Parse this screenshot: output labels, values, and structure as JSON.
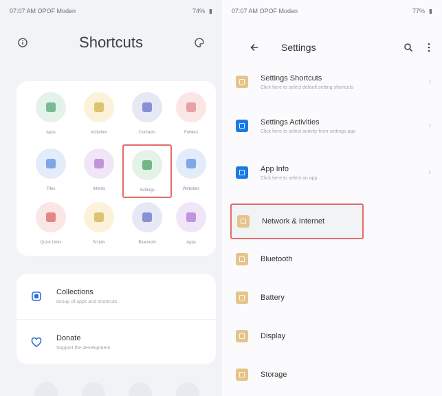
{
  "colors": {
    "highlight": "#e36b6b",
    "settings_orange": "#e5c48a",
    "settings_blue": "#1a7be6",
    "accent_blue": "#2e6fd8"
  },
  "left_panel": {
    "status": {
      "time_carrier": "07:07 AM  OPOF  Moden",
      "battery": "74%"
    },
    "header": {
      "title": "Shortcuts",
      "left_icon": "info-icon",
      "right_icon": "palette-icon"
    },
    "tiles": [
      {
        "label": "Apps",
        "bg": "#e4f3ea",
        "fg": "#5aa77a",
        "icon": "apps-icon"
      },
      {
        "label": "Activities",
        "bg": "#fbf2d9",
        "fg": "#d6b24b",
        "icon": "activities-icon"
      },
      {
        "label": "Contacts",
        "bg": "#e6e8f6",
        "fg": "#6b73c9",
        "icon": "contacts-icon"
      },
      {
        "label": "Folders",
        "bg": "#fbe6e6",
        "fg": "#e08c8c",
        "icon": "folder-icon"
      },
      {
        "label": "Files",
        "bg": "#e3ecfb",
        "fg": "#5f8fe0",
        "icon": "file-icon"
      },
      {
        "label": "Intents",
        "bg": "#f1e6f8",
        "fg": "#b07ad6",
        "icon": "intent-icon"
      },
      {
        "label": "Settings",
        "bg": "#e4f2e7",
        "fg": "#4ea067",
        "icon": "settings-icon"
      },
      {
        "label": "Websites",
        "bg": "#e3ecfb",
        "fg": "#5f8fe0",
        "icon": "web-icon"
      },
      {
        "label": "Quick Links",
        "bg": "#fbe6e6",
        "fg": "#e06666",
        "icon": "close-icon"
      },
      {
        "label": "Scripts",
        "bg": "#fbf2d9",
        "fg": "#d6b24b",
        "icon": "script-icon"
      },
      {
        "label": "Bluetooth",
        "bg": "#e6e8f6",
        "fg": "#6b73c9",
        "icon": "bluetooth-icon"
      },
      {
        "label": "Apps",
        "bg": "#f1e6f8",
        "fg": "#b07ad6",
        "icon": "grid-icon"
      }
    ],
    "collections": {
      "title": "Collections",
      "subtitle": "Group of apps and shortcuts"
    },
    "donate": {
      "title": "Donate",
      "subtitle": "Support the development"
    }
  },
  "right_panel": {
    "status": {
      "time_carrier": "07:07 AM  OPOF  Moden",
      "battery": "77%"
    },
    "header": {
      "title": "Settings",
      "back_icon": "back-arrow-icon",
      "search_icon": "search-icon",
      "menu_icon": "more-vert-icon"
    },
    "items": [
      {
        "title": "Settings Shortcuts",
        "subtitle": "Click here to select default setting shortcuts",
        "color": "#e5c48a",
        "chevron": "›"
      },
      {
        "title": "Settings Activities",
        "subtitle": "Click here to select activity from settings app",
        "color": "#1a7be6",
        "chevron": "›"
      },
      {
        "title": "App Info",
        "subtitle": "Click here to select an app",
        "color": "#1a7be6",
        "chevron": "›"
      },
      {
        "title": "Network & Internet",
        "subtitle": "",
        "color": "#e5c48a",
        "chevron": ""
      },
      {
        "title": "Bluetooth",
        "subtitle": "",
        "color": "#e5c48a",
        "chevron": ""
      },
      {
        "title": "Battery",
        "subtitle": "",
        "color": "#e5c48a",
        "chevron": ""
      },
      {
        "title": "Display",
        "subtitle": "",
        "color": "#e5c48a",
        "chevron": ""
      },
      {
        "title": "Storage",
        "subtitle": "",
        "color": "#e5c48a",
        "chevron": ""
      }
    ]
  }
}
